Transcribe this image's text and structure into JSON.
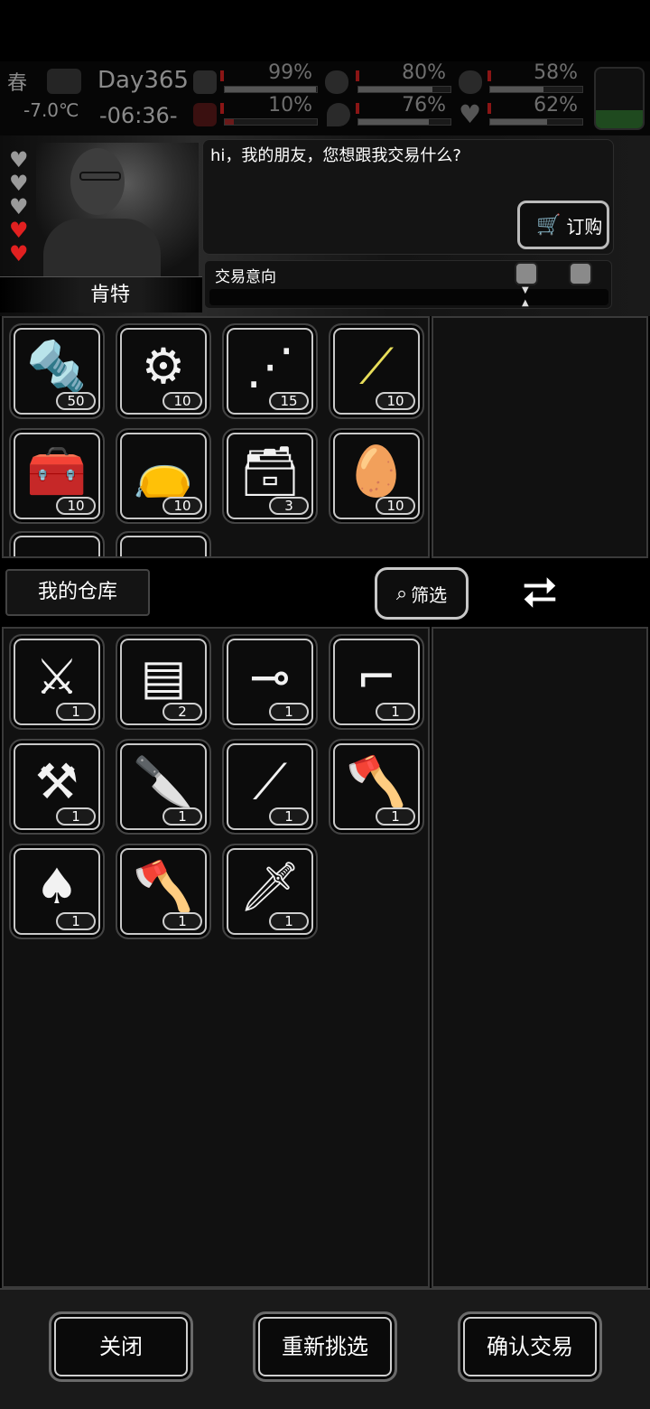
{
  "hud": {
    "season": "春",
    "day": "Day365",
    "temperature": "-7.0℃",
    "time": "-06:36-",
    "stats": [
      {
        "name": "health-kit",
        "value": "99%",
        "fraction": 0.99
      },
      {
        "name": "stomach",
        "value": "80%",
        "fraction": 0.8
      },
      {
        "name": "armor",
        "value": "58%",
        "fraction": 0.58
      },
      {
        "name": "infection",
        "value": "10%",
        "fraction": 0.1
      },
      {
        "name": "water",
        "value": "76%",
        "fraction": 0.76
      },
      {
        "name": "mood",
        "value": "62%",
        "fraction": 0.62
      }
    ]
  },
  "npc": {
    "name": "肯特",
    "dialog": "hi，我的朋友，您想跟我交易什么?",
    "order_label": "订购",
    "trade_intent_label": "交易意向",
    "hearts": [
      "grey",
      "grey",
      "grey",
      "red",
      "red"
    ]
  },
  "merchant_items": [
    {
      "icon": "screws",
      "glyph": "🔩",
      "count": "50"
    },
    {
      "icon": "gears",
      "glyph": "⚙",
      "count": "10"
    },
    {
      "icon": "rubble",
      "glyph": "⋰",
      "count": "15"
    },
    {
      "icon": "yellow-sticks",
      "glyph": "⟋",
      "count": "10",
      "yellow": true
    },
    {
      "icon": "toolbag",
      "glyph": "🧰",
      "count": "10"
    },
    {
      "icon": "sack",
      "glyph": "👝",
      "count": "10"
    },
    {
      "icon": "toolbox",
      "glyph": "🗃",
      "count": "3"
    },
    {
      "icon": "leather",
      "glyph": "🥚",
      "count": "10"
    }
  ],
  "warehouse": {
    "label": "我的仓库",
    "filter_label": "筛选",
    "items": [
      {
        "icon": "crossbow",
        "glyph": "⚔",
        "count": "1"
      },
      {
        "icon": "minigun",
        "glyph": "▤",
        "count": "2"
      },
      {
        "icon": "rocket-launcher",
        "glyph": "⊸",
        "count": "1"
      },
      {
        "icon": "sniper-rifle",
        "glyph": "⌐",
        "count": "1"
      },
      {
        "icon": "machete",
        "glyph": "⚒",
        "count": "1"
      },
      {
        "icon": "cleaver",
        "glyph": "🔪",
        "count": "1"
      },
      {
        "icon": "screwdriver",
        "glyph": "⟋",
        "count": "1"
      },
      {
        "icon": "hatchet",
        "glyph": "🪓",
        "count": "1"
      },
      {
        "icon": "shovel",
        "glyph": "♠",
        "count": "1"
      },
      {
        "icon": "axe",
        "glyph": "🪓",
        "count": "1"
      },
      {
        "icon": "knife",
        "glyph": "🗡",
        "count": "1"
      }
    ]
  },
  "buttons": {
    "close": "关闭",
    "reselect": "重新挑选",
    "confirm": "确认交易"
  }
}
